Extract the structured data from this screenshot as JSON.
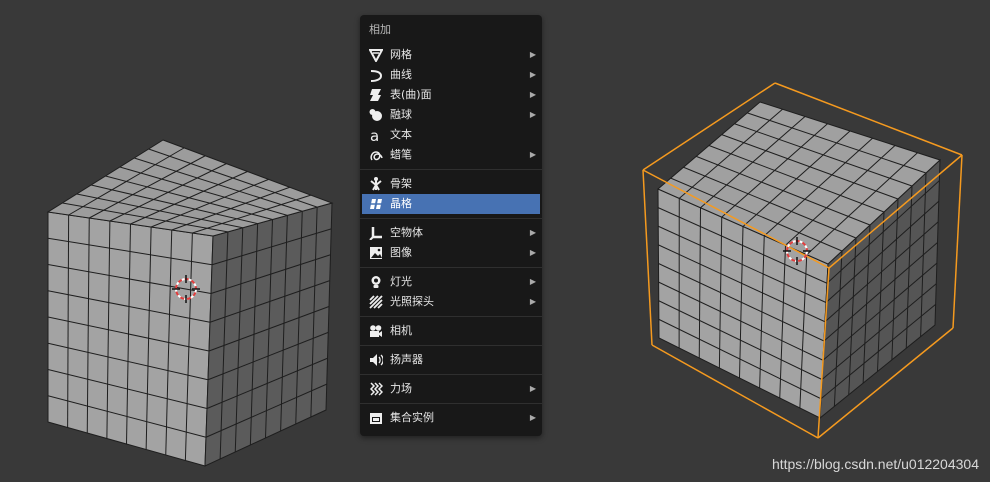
{
  "menu": {
    "title": "相加",
    "groups": [
      [
        {
          "label": "网格",
          "icon": "mesh-icon",
          "submenu": true
        },
        {
          "label": "曲线",
          "icon": "curve-icon",
          "submenu": true
        },
        {
          "label": "表(曲)面",
          "icon": "surface-icon",
          "submenu": true
        },
        {
          "label": "融球",
          "icon": "metaball-icon",
          "submenu": true
        },
        {
          "label": "文本",
          "icon": "text-icon",
          "submenu": false
        },
        {
          "label": "蜡笔",
          "icon": "grease-pencil-icon",
          "submenu": true
        }
      ],
      [
        {
          "label": "骨架",
          "icon": "armature-icon",
          "submenu": false
        },
        {
          "label": "晶格",
          "icon": "lattice-icon",
          "submenu": false,
          "active": true
        }
      ],
      [
        {
          "label": "空物体",
          "icon": "empty-icon",
          "submenu": true
        },
        {
          "label": "图像",
          "icon": "image-icon",
          "submenu": true
        }
      ],
      [
        {
          "label": "灯光",
          "icon": "light-icon",
          "submenu": true
        },
        {
          "label": "光照探头",
          "icon": "light-probe-icon",
          "submenu": true
        }
      ],
      [
        {
          "label": "相机",
          "icon": "camera-icon",
          "submenu": false
        }
      ],
      [
        {
          "label": "扬声器",
          "icon": "speaker-icon",
          "submenu": false
        }
      ],
      [
        {
          "label": "力场",
          "icon": "force-field-icon",
          "submenu": true
        }
      ],
      [
        {
          "label": "集合实例",
          "icon": "collection-instance-icon",
          "submenu": true
        }
      ]
    ]
  },
  "colors": {
    "background": "#393939",
    "menu": "#181818",
    "highlight": "#4772b3",
    "lattice_outline": "#f59a1f",
    "cube_face": "#a3a3a3"
  },
  "watermark": "https://blog.csdn.net/u012204304"
}
